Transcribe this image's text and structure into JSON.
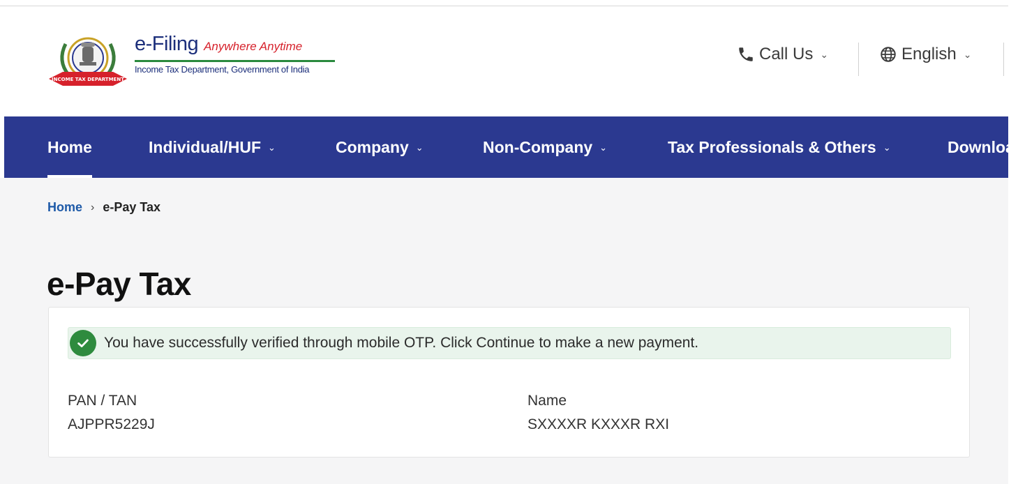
{
  "header": {
    "brand_title": "e-Filing",
    "brand_tagline": "Anywhere Anytime",
    "brand_subtitle": "Income Tax Department, Government of India",
    "emblem_banner_text": "INCOME TAX DEPARTMENT",
    "call_us_label": "Call Us",
    "language_label": "English"
  },
  "nav": {
    "items": [
      {
        "label": "Home",
        "active": true
      },
      {
        "label": "Individual/HUF"
      },
      {
        "label": "Company"
      },
      {
        "label": "Non-Company"
      },
      {
        "label": "Tax Professionals & Others"
      },
      {
        "label": "Downloa"
      }
    ]
  },
  "breadcrumb": {
    "home": "Home",
    "separator": "›",
    "current": "e-Pay Tax"
  },
  "page": {
    "title": "e-Pay Tax"
  },
  "alert": {
    "message": "You have successfully verified through mobile OTP. Click Continue to make a new payment.",
    "status": "success",
    "icon": "check-circle-icon",
    "color": "#2e8b3e"
  },
  "details": {
    "pan_label": "PAN / TAN",
    "pan_value": "AJPPR5229J",
    "name_label": "Name",
    "name_value": "SXXXXR KXXXR RXI"
  },
  "colors": {
    "nav_background": "#2b3990",
    "brand_blue": "#1c2f7b",
    "brand_red": "#d6212b",
    "link_blue": "#1e5aa8",
    "alert_background": "#e9f4ec"
  }
}
